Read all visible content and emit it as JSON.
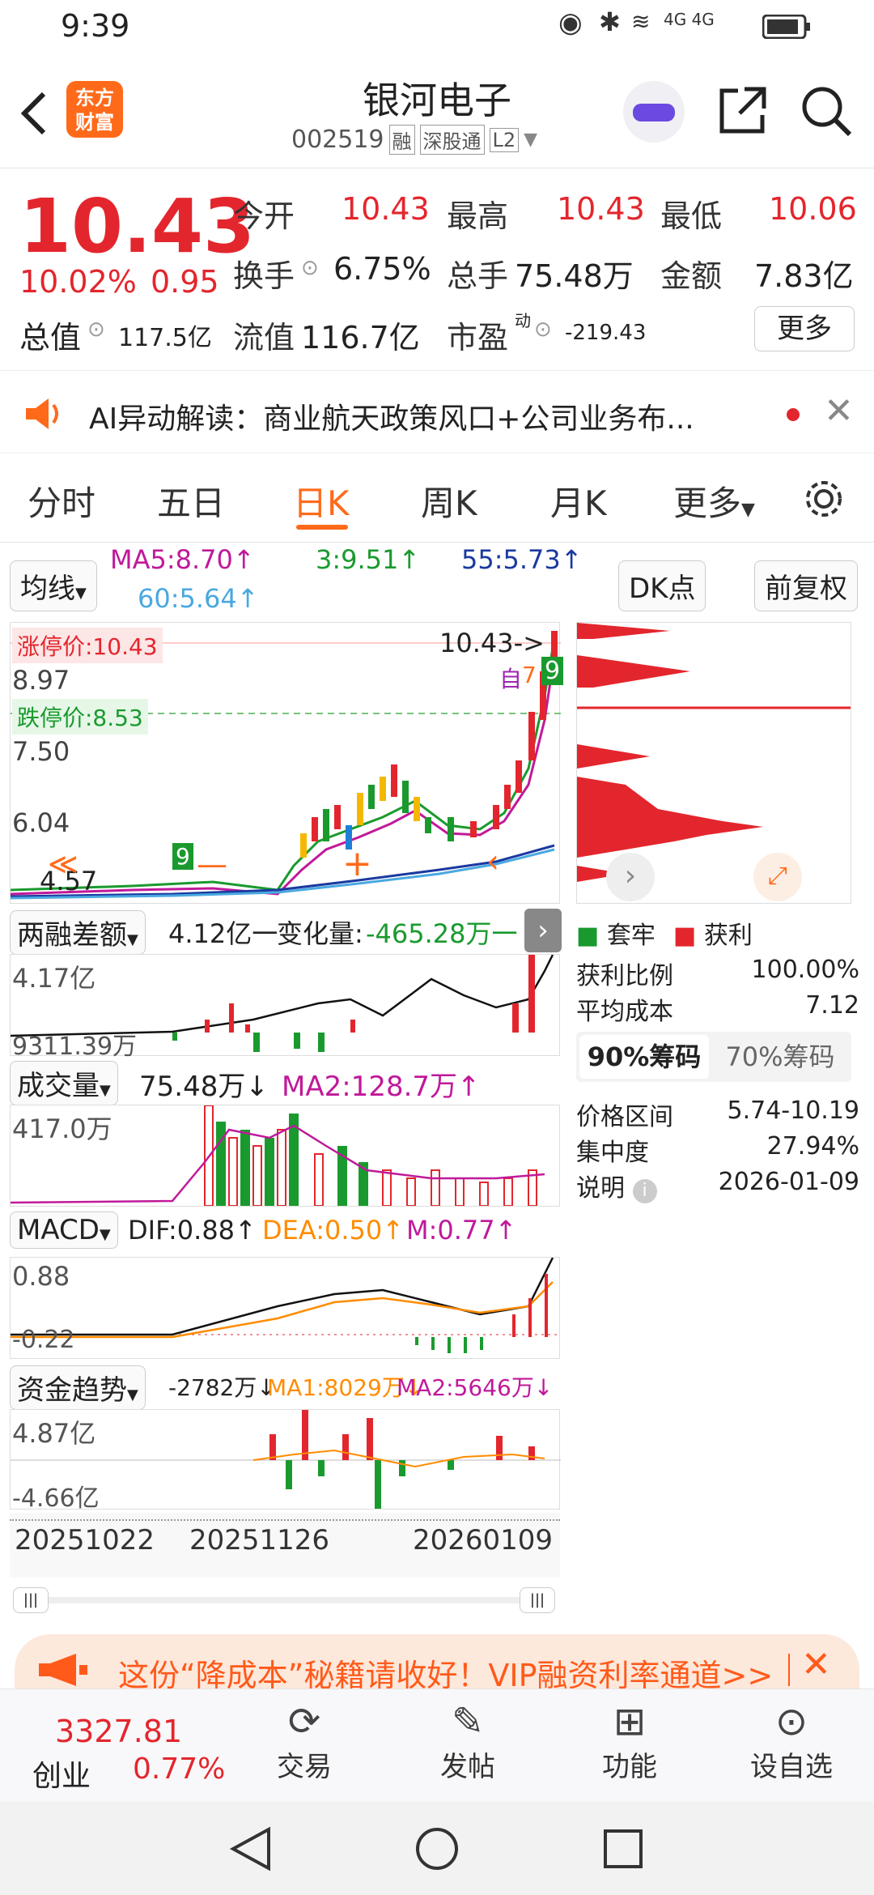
{
  "status_bar": {
    "time": "9:39",
    "net_icons": "4G 4G"
  },
  "header": {
    "logo_line1": "东方",
    "logo_line2": "财富",
    "stock_name": "银河电子",
    "stock_code": "002519",
    "tags": [
      "融",
      "深股通",
      "L2"
    ]
  },
  "quote": {
    "price": "10.43",
    "change_pct": "10.02%",
    "change_abs": "0.95",
    "open_label": "今开",
    "open": "10.43",
    "high_label": "最高",
    "high": "10.43",
    "low_label": "最低",
    "low": "10.06",
    "turnover_label": "换手",
    "turnover": "6.75%",
    "volume_label": "总手",
    "volume": "75.48万",
    "amount_label": "金额",
    "amount": "7.83亿",
    "mktcap_label": "总值",
    "mktcap": "117.5亿",
    "float_label": "流值",
    "float_val": "116.7亿",
    "pe_label": "市盈",
    "pe_sup": "动",
    "pe": "-219.43",
    "more_btn": "更多"
  },
  "ai_banner": {
    "text": "AI异动解读：商业航天政策风口+公司业务布..."
  },
  "tabs": [
    "分时",
    "五日",
    "日K",
    "周K",
    "月K",
    "更多"
  ],
  "active_tab": "日K",
  "indicators": {
    "ma_select": "均线",
    "ma5": "MA5:8.70↑",
    "ma3": "3:9.51↑",
    "ma55": "55:5.73↑",
    "ma60": "60:5.64↑",
    "dk_btn": "DK点",
    "fq_btn": "前复权"
  },
  "kchart": {
    "limit_up": "涨停价:10.43",
    "price_897": "8.97",
    "limit_down": "跌停价:8.53",
    "price_750": "7.50",
    "price_604": "6.04",
    "price_457": "4.57",
    "last_arrow": "10.43->",
    "badge_zi": "自",
    "badge_7": "7",
    "badge_9": "9",
    "left_badge": "9"
  },
  "chips": {
    "legend_stuck": "套牢",
    "legend_profit": "获利",
    "profit_ratio_label": "获利比例",
    "profit_ratio": "100.00%",
    "avg_cost_label": "平均成本",
    "avg_cost": "7.12",
    "tab90": "90%筹码",
    "tab70": "70%筹码",
    "range_label": "价格区间",
    "range": "5.74-10.19",
    "concentration_label": "集中度",
    "concentration": "27.94%",
    "note_label": "说明",
    "note_date": "2026-01-09"
  },
  "margin": {
    "select": "两融差额",
    "value": "4.12亿一",
    "change_label": "变化量:",
    "change": "-465.28万一",
    "top": "4.17亿",
    "bottom": "9311.39万"
  },
  "volume_panel": {
    "select": "成交量",
    "value": "75.48万↓",
    "ma2": "MA2:128.7万↑",
    "top": "417.0万"
  },
  "macd": {
    "select": "MACD",
    "dif": "DIF:0.88↑",
    "dea": "DEA:0.50↑",
    "m": "M:0.77↑",
    "top": "0.88",
    "bottom": "-0.22"
  },
  "fund": {
    "select": "资金趋势",
    "value": "-2782万↓",
    "ma1": "MA1:8029万↓",
    "ma2": "MA2:5646万↓",
    "top": "4.87亿",
    "bottom": "-4.66亿"
  },
  "dates": [
    "20251022",
    "20251126",
    "20260109"
  ],
  "promo": {
    "text": "这份“降成本”秘籍请收好！VIP融资利率通道>>"
  },
  "bottom_nav": {
    "index_value": "3327.81",
    "index_name": "创业",
    "index_change": "0.77%",
    "items": [
      "交易",
      "发帖",
      "功能",
      "设自选"
    ]
  },
  "colors": {
    "up": "#e3262d",
    "down": "#1a9a2e",
    "accent": "#ff6a1a"
  }
}
